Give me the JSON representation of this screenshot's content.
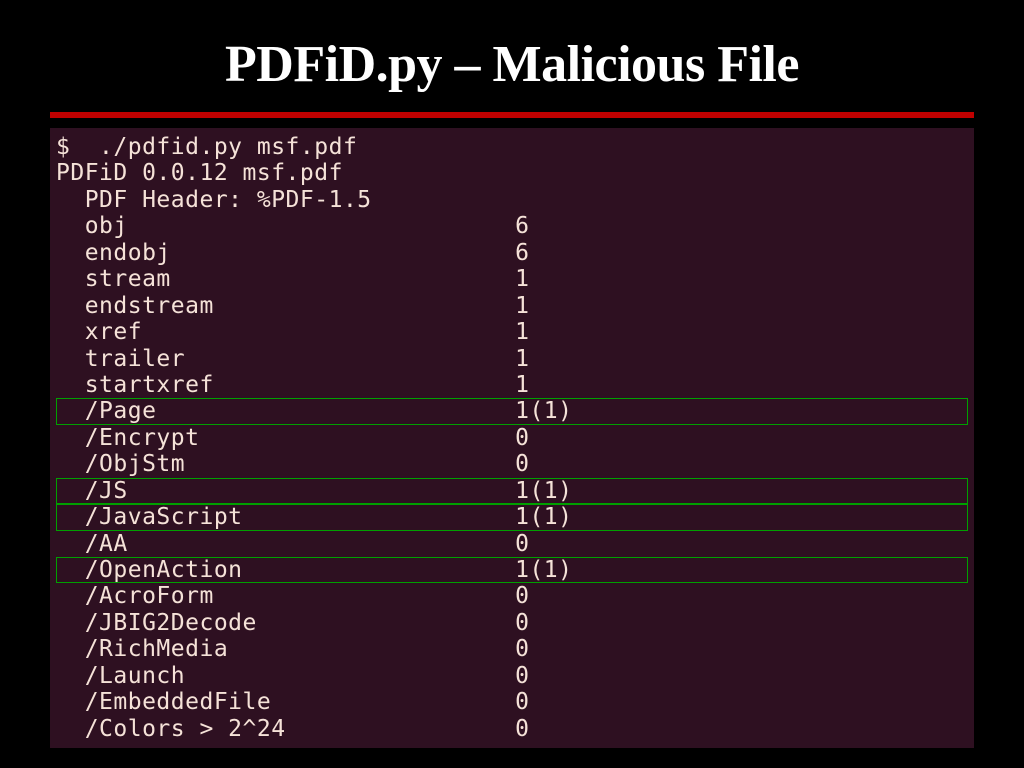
{
  "title": "PDFiD.py – Malicious File",
  "terminal": {
    "header_lines": [
      "$  ./pdfid.py msf.pdf",
      "PDFiD 0.0.12 msf.pdf",
      "  PDF Header: %PDF-1.5"
    ],
    "rows": [
      {
        "key": "  obj",
        "value": "6",
        "highlighted": false
      },
      {
        "key": "  endobj",
        "value": "6",
        "highlighted": false
      },
      {
        "key": "  stream",
        "value": "1",
        "highlighted": false
      },
      {
        "key": "  endstream",
        "value": "1",
        "highlighted": false
      },
      {
        "key": "  xref",
        "value": "1",
        "highlighted": false
      },
      {
        "key": "  trailer",
        "value": "1",
        "highlighted": false
      },
      {
        "key": "  startxref",
        "value": "1",
        "highlighted": false
      },
      {
        "key": "  /Page",
        "value": "1(1)",
        "highlighted": true
      },
      {
        "key": "  /Encrypt",
        "value": "0",
        "highlighted": false
      },
      {
        "key": "  /ObjStm",
        "value": "0",
        "highlighted": false
      },
      {
        "key": "  /JS",
        "value": "1(1)",
        "highlighted": true
      },
      {
        "key": "  /JavaScript",
        "value": "1(1)",
        "highlighted": true
      },
      {
        "key": "  /AA",
        "value": "0",
        "highlighted": false
      },
      {
        "key": "  /OpenAction",
        "value": "1(1)",
        "highlighted": true
      },
      {
        "key": "  /AcroForm",
        "value": "0",
        "highlighted": false
      },
      {
        "key": "  /JBIG2Decode",
        "value": "0",
        "highlighted": false
      },
      {
        "key": "  /RichMedia",
        "value": "0",
        "highlighted": false
      },
      {
        "key": "  /Launch",
        "value": "0",
        "highlighted": false
      },
      {
        "key": "  /EmbeddedFile",
        "value": "0",
        "highlighted": false
      },
      {
        "key": "  /Colors > 2^24",
        "value": "0",
        "highlighted": false
      }
    ],
    "key_column_width": 32
  }
}
